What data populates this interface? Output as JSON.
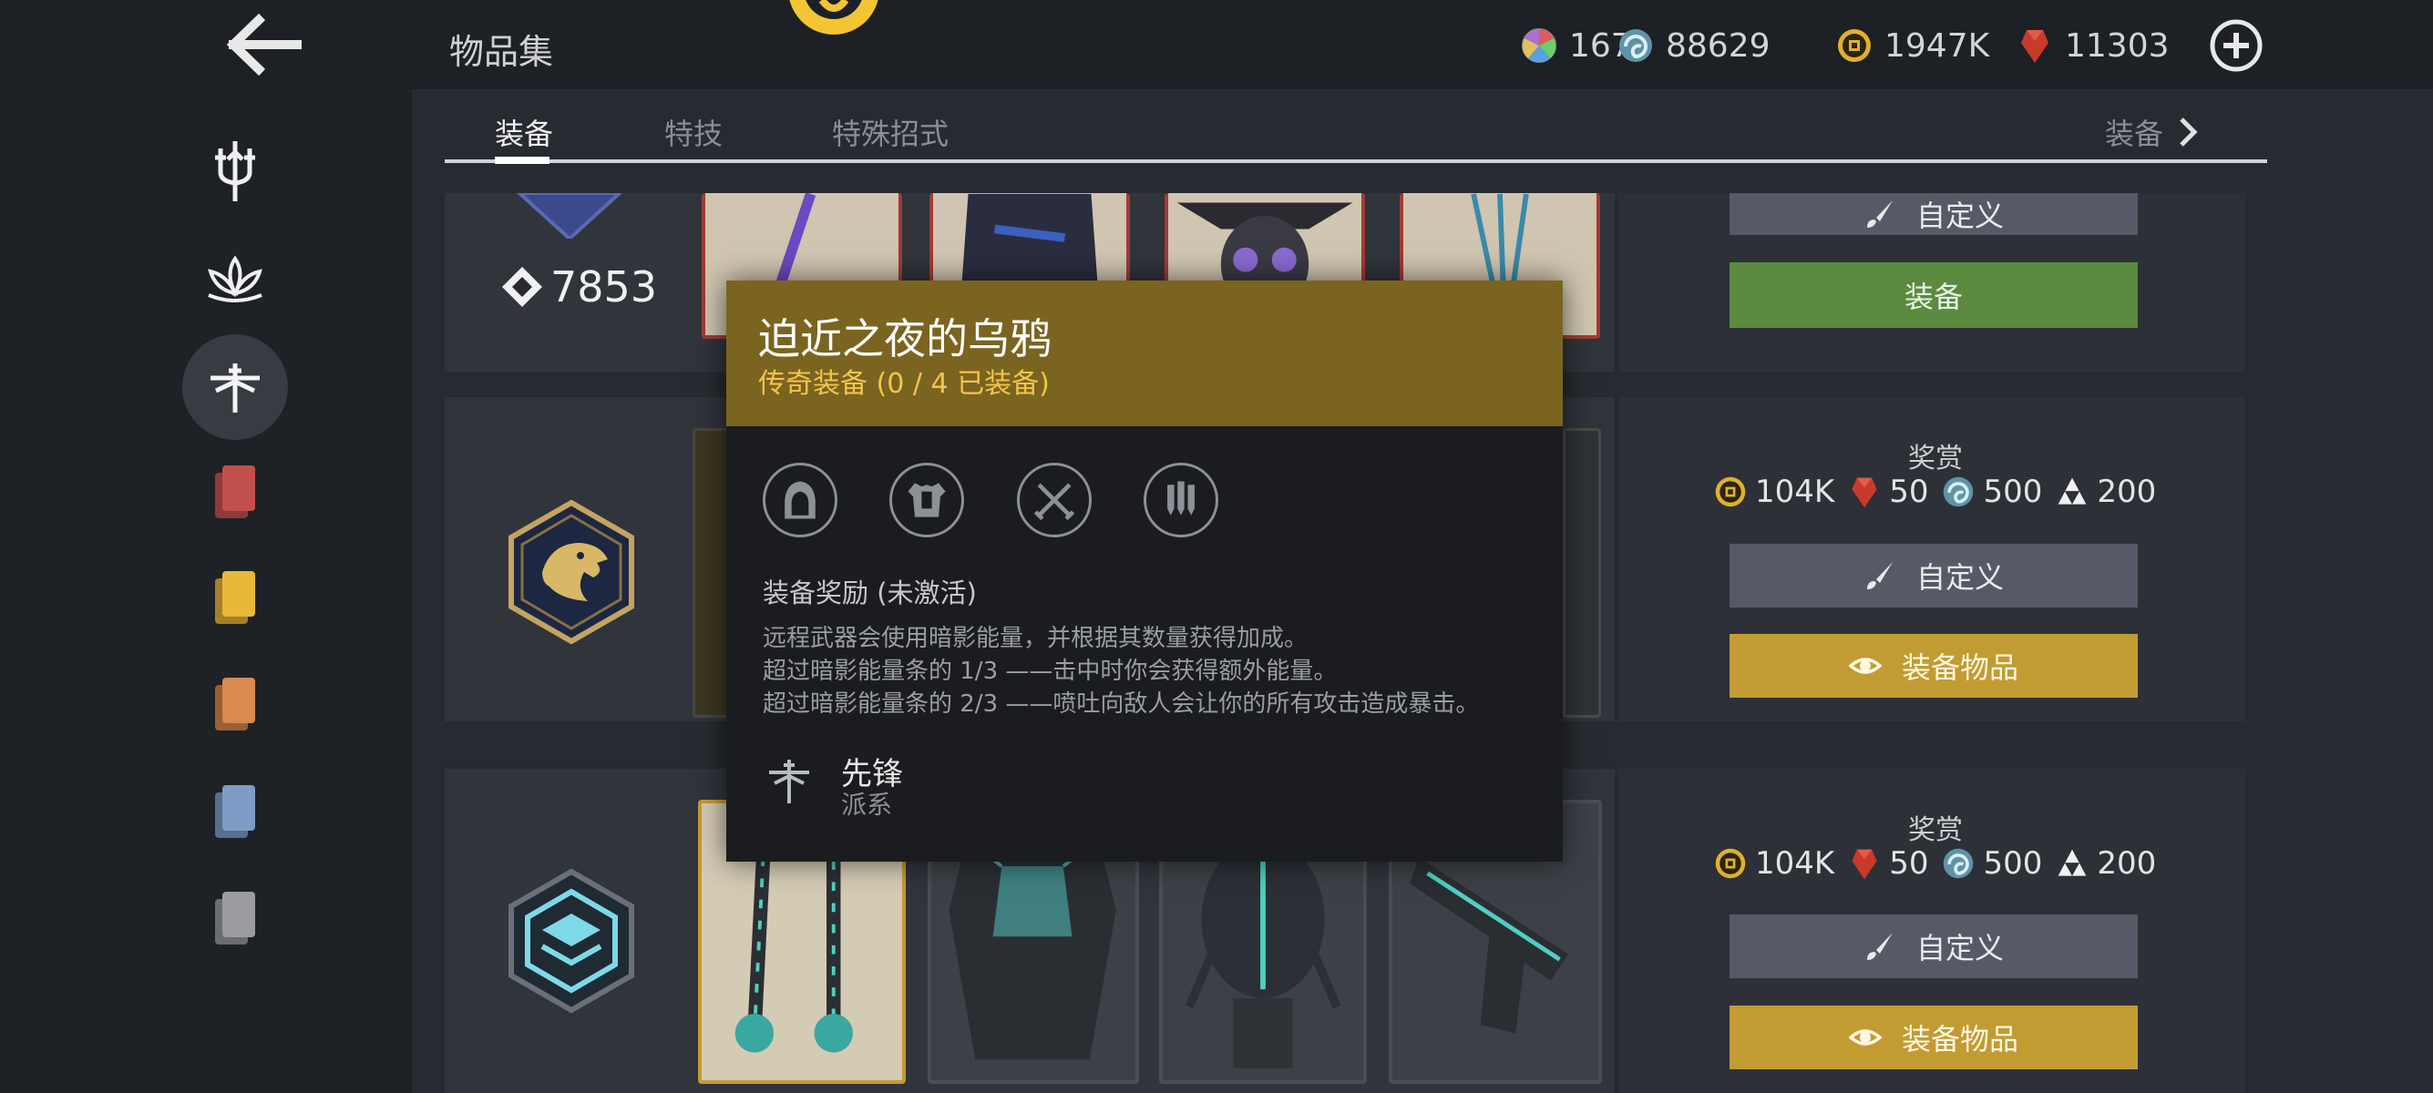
{
  "header": {
    "title": "物品集",
    "back_icon": "arrow-left-icon",
    "add_icon": "plus-circle-icon"
  },
  "currencies": [
    {
      "icon": "prism-icon",
      "value": "167"
    },
    {
      "icon": "swirl-coin-icon",
      "value": "88629"
    },
    {
      "icon": "gold-coin-icon",
      "value": "1947K"
    },
    {
      "icon": "ruby-icon",
      "value": "11303"
    }
  ],
  "tabs": [
    {
      "label": "装备",
      "active": true
    },
    {
      "label": "特技",
      "active": false
    },
    {
      "label": "特殊招式",
      "active": false
    }
  ],
  "tab_more": {
    "label": "装备"
  },
  "sidebar": [
    {
      "icon": "trident-emblem-icon"
    },
    {
      "icon": "lotus-emblem-icon"
    },
    {
      "icon": "dragonfly-emblem-icon",
      "active": true
    },
    {
      "icon": "red-cards-icon",
      "color": "#c0504d"
    },
    {
      "icon": "yellow-cards-icon",
      "color": "#e8b83a"
    },
    {
      "icon": "orange-cards-icon",
      "color": "#d98a4e"
    },
    {
      "icon": "blue-cards-icon",
      "color": "#7e9cc6"
    },
    {
      "icon": "gray-cards-icon",
      "color": "#9a9ca0"
    }
  ],
  "sets": [
    {
      "score": "7853",
      "customize_label": "自定义",
      "equip_label": "装备"
    },
    {
      "reward_title": "奖赏",
      "rewards": [
        "104K",
        "50",
        "500",
        "200"
      ],
      "customize_label": "自定义",
      "equip_label": "装备物品"
    },
    {
      "reward_title": "奖赏",
      "rewards": [
        "104K",
        "50",
        "500",
        "200"
      ],
      "customize_label": "自定义",
      "equip_label": "装备物品"
    }
  ],
  "popup": {
    "name": "迫近之夜的乌鸦",
    "subtitle": "传奇装备 (0 / 4 已装备)",
    "slots": [
      "hood-icon",
      "armor-icon",
      "crossed-swords-icon",
      "throwing-daggers-icon"
    ],
    "bonus_title": "装备奖励 (未激活)",
    "bonus_lines": [
      "远程武器会使用暗影能量，并根据其数量获得加成。",
      "超过暗影能量条的 1/3 ——击中时你会获得额外能量。",
      "超过暗影能量条的 2/3 ——喷吐向敌人会让你的所有攻击造成暴击。"
    ],
    "faction_name": "先锋",
    "faction_label": "派系"
  },
  "colors": {
    "accent_gold": "#c39b33",
    "equip_green": "#5a8b3f",
    "popup_header": "#7b6420",
    "legendary_text": "#f2c54b"
  }
}
